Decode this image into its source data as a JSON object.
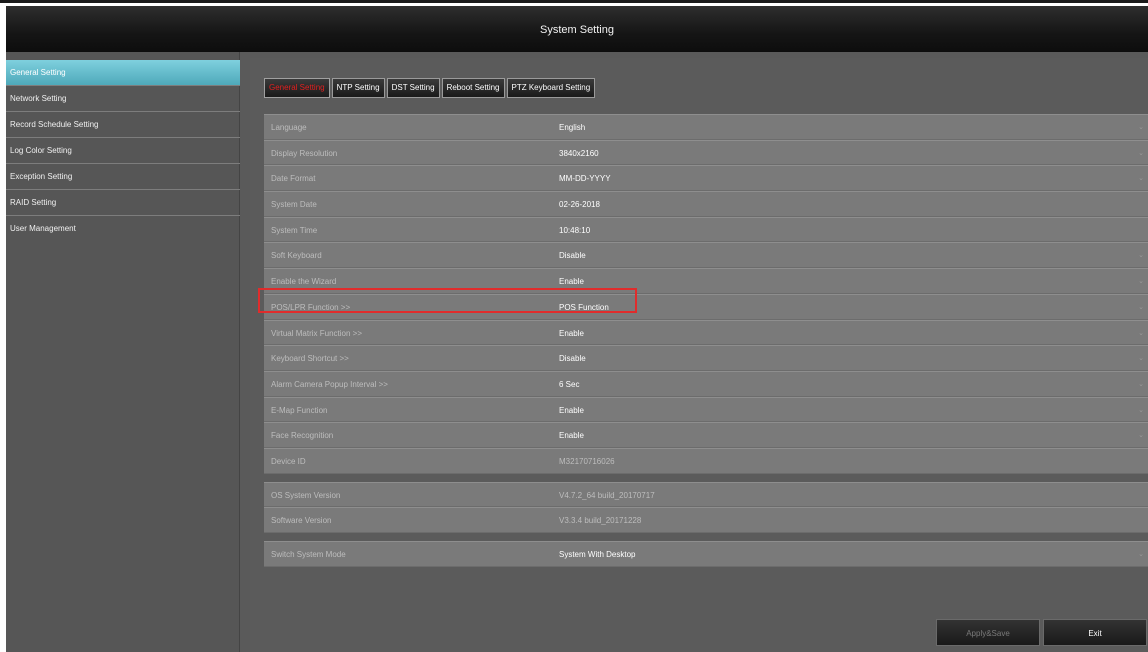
{
  "window": {
    "title": "System Setting"
  },
  "sidebar": {
    "items": [
      {
        "label": "General Setting",
        "active": true
      },
      {
        "label": "Network Setting",
        "active": false
      },
      {
        "label": "Record Schedule Setting",
        "active": false
      },
      {
        "label": "Log Color Setting",
        "active": false
      },
      {
        "label": "Exception Setting",
        "active": false
      },
      {
        "label": "RAID Setting",
        "active": false
      },
      {
        "label": "User Management",
        "active": false
      }
    ]
  },
  "tabs": [
    {
      "label": "General Setting",
      "active": true
    },
    {
      "label": "NTP Setting",
      "active": false
    },
    {
      "label": "DST Setting",
      "active": false
    },
    {
      "label": "Reboot Setting",
      "active": false
    },
    {
      "label": "PTZ Keyboard Setting",
      "active": false
    }
  ],
  "settings": [
    {
      "label": "Language",
      "value": "English"
    },
    {
      "label": "Display Resolution",
      "value": "3840x2160"
    },
    {
      "label": "Date Format",
      "value": "MM-DD-YYYY"
    },
    {
      "label": "System Date",
      "value": "02-26-2018"
    },
    {
      "label": "System Time",
      "value": "10:48:10"
    },
    {
      "label": "Soft Keyboard",
      "value": "Disable"
    },
    {
      "label": "Enable the Wizard",
      "value": "Enable"
    },
    {
      "label": "POS/LPR Function >>",
      "value": "POS Function"
    },
    {
      "label": "Virtual Matrix Function >>",
      "value": "Enable"
    },
    {
      "label": "Keyboard Shortcut >>",
      "value": "Disable"
    },
    {
      "label": "Alarm Camera Popup Interval >>",
      "value": "6 Sec"
    },
    {
      "label": "E-Map Function",
      "value": "Enable"
    },
    {
      "label": "Face Recognition",
      "value": "Enable"
    },
    {
      "label": "Device ID",
      "value": "M32170716026"
    },
    {
      "label": "OS System Version",
      "value": "V4.7.2_64 build_20170717"
    },
    {
      "label": "Software Version",
      "value": "V3.3.4 build_20171228"
    },
    {
      "label": "Switch System Mode",
      "value": "System With Desktop"
    }
  ],
  "caret_glyph": "⌄",
  "buttons": {
    "apply": "Apply&Save",
    "exit": "Exit"
  },
  "colors": {
    "accent": "#4ea9ba",
    "highlight_border": "#e02c2c",
    "active_tab_text": "#e02020"
  }
}
